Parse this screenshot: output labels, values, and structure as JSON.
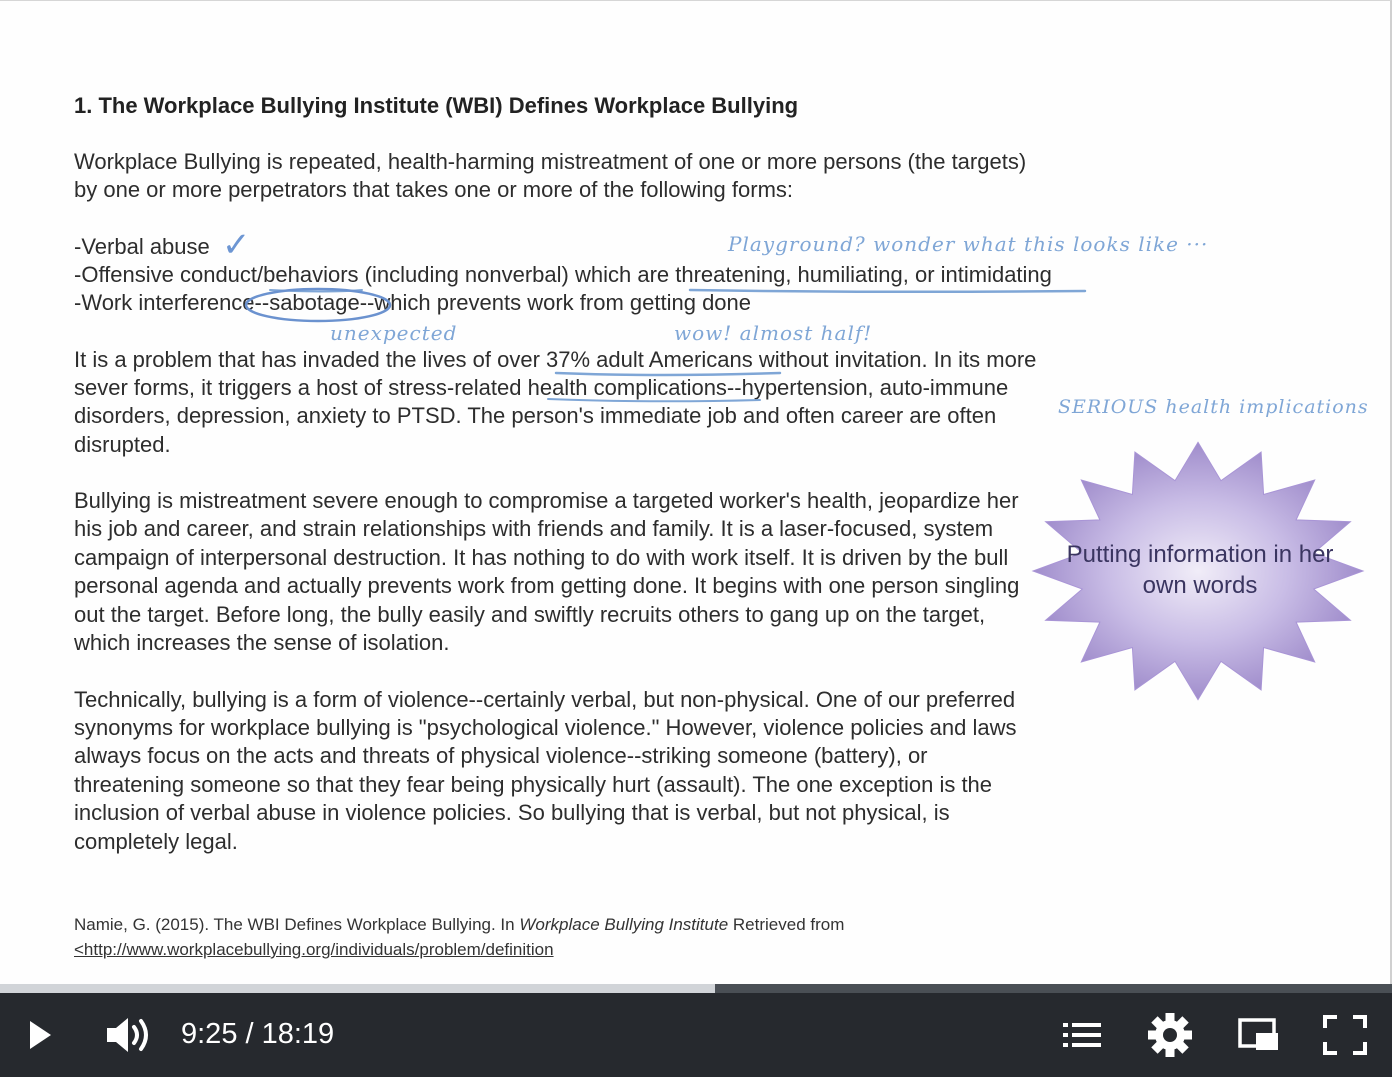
{
  "slide": {
    "title": "1. The Workplace Bullying Institute (WBI) Defines Workplace Bullying",
    "intro_lines": [
      "Workplace Bullying is repeated, health-harming mistreatment of one or more persons (the targets)",
      "by one or more perpetrators that takes one or more of the following forms:"
    ],
    "forms": [
      "-Verbal abuse",
      "-Offensive conduct/behaviors (including nonverbal) which are threatening, humiliating, or intimidating",
      "-Work interference--sabotage--which prevents work from getting done"
    ],
    "para1_lines": [
      "It is a problem that has invaded the lives of over 37% adult Americans without invitation. In its more",
      "sever forms, it triggers a host of stress-related health complications--hypertension, auto-immune",
      "disorders, depression, anxiety to PTSD. The person's immediate job and often career are often",
      "disrupted."
    ],
    "para2_lines": [
      "Bullying is mistreatment severe enough to compromise a targeted worker's health, jeopardize her",
      "his job and career, and strain relationships with friends and family. It is a laser-focused, system",
      "campaign of interpersonal destruction. It has nothing to do with work itself. It is driven by the bull",
      "personal agenda and actually prevents work from getting done. It begins with one person singling",
      "out the target. Before long, the bully easily and swiftly recruits others to gang up on the target,",
      "which increases the sense of isolation."
    ],
    "para3_lines": [
      "Technically, bullying is a form of violence--certainly verbal, but non-physical. One of our preferred",
      "synonyms for workplace bullying is \"psychological violence.\" However, violence policies and laws",
      "always focus on the acts and threats of physical violence--striking someone (battery), or",
      "threatening someone so that they fear being physically hurt (assault). The one exception is the",
      "inclusion of verbal abuse in violence policies. So bullying that is verbal, but not physical, is",
      "completely legal."
    ],
    "citation": {
      "prefix": "Namie, G. (2015). The WBI Defines Workplace Bullying. In ",
      "source": "Workplace Bullying Institute",
      "suffix": " Retrieved from",
      "url": "<http://www.workplacebullying.org/individuals/problem/definition"
    }
  },
  "annotations": {
    "checkmark": "✓",
    "playground": "Playground? wonder what this looks like ···",
    "unexpected": "unexpected",
    "almost_half": "wow! almost half!",
    "serious": "SERIOUS health implications",
    "callout": "Putting information in her own words",
    "ink_color": "#7fa6d6",
    "callout_color": "#9a86c8"
  },
  "player": {
    "time_display": "9:25 / 18:19",
    "progress_fraction": 0.5135,
    "icons": {
      "play": "play-icon",
      "volume": "volume-icon",
      "chapters": "chapters-list-icon",
      "settings": "gear-icon",
      "pip": "picture-in-picture-icon",
      "fullscreen": "fullscreen-icon"
    }
  }
}
